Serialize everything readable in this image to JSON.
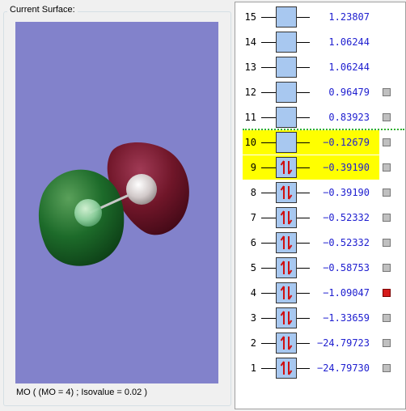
{
  "group_title": "Current Surface:",
  "caption": "MO ( (MO = 4) ; Isovalue = 0.02 )",
  "colors": {
    "viewport_bg": "#8282cb",
    "positive_lobe": "#1f6b2a",
    "negative_lobe": "#7a1830",
    "highlight": "#ffff00",
    "occupied_marker": "#d61c1c",
    "energy_text": "#2020d0"
  },
  "levels": [
    {
      "num": "15",
      "energy": "1.23807",
      "occupied": false,
      "checkbox": false,
      "selected": false,
      "highlight": false
    },
    {
      "num": "14",
      "energy": "1.06244",
      "occupied": false,
      "checkbox": false,
      "selected": false,
      "highlight": false
    },
    {
      "num": "13",
      "energy": "1.06244",
      "occupied": false,
      "checkbox": false,
      "selected": false,
      "highlight": false
    },
    {
      "num": "12",
      "energy": "0.96479",
      "occupied": false,
      "checkbox": true,
      "selected": false,
      "highlight": false
    },
    {
      "num": "11",
      "energy": "0.83923",
      "occupied": false,
      "checkbox": true,
      "selected": false,
      "highlight": false
    },
    {
      "num": "10",
      "energy": "-0.12679",
      "occupied": false,
      "checkbox": true,
      "selected": false,
      "highlight": true
    },
    {
      "num": "9",
      "energy": "-0.39190",
      "occupied": true,
      "checkbox": true,
      "selected": false,
      "highlight": true
    },
    {
      "num": "8",
      "energy": "-0.39190",
      "occupied": true,
      "checkbox": true,
      "selected": false,
      "highlight": false
    },
    {
      "num": "7",
      "energy": "-0.52332",
      "occupied": true,
      "checkbox": true,
      "selected": false,
      "highlight": false
    },
    {
      "num": "6",
      "energy": "-0.52332",
      "occupied": true,
      "checkbox": true,
      "selected": false,
      "highlight": false
    },
    {
      "num": "5",
      "energy": "-0.58753",
      "occupied": true,
      "checkbox": true,
      "selected": false,
      "highlight": false
    },
    {
      "num": "4",
      "energy": "-1.09047",
      "occupied": true,
      "checkbox": true,
      "selected": true,
      "highlight": false
    },
    {
      "num": "3",
      "energy": "-1.33659",
      "occupied": true,
      "checkbox": true,
      "selected": false,
      "highlight": false
    },
    {
      "num": "2",
      "energy": "-24.79723",
      "occupied": true,
      "checkbox": true,
      "selected": false,
      "highlight": false
    },
    {
      "num": "1",
      "energy": "-24.79730",
      "occupied": true,
      "checkbox": true,
      "selected": false,
      "highlight": false
    }
  ]
}
